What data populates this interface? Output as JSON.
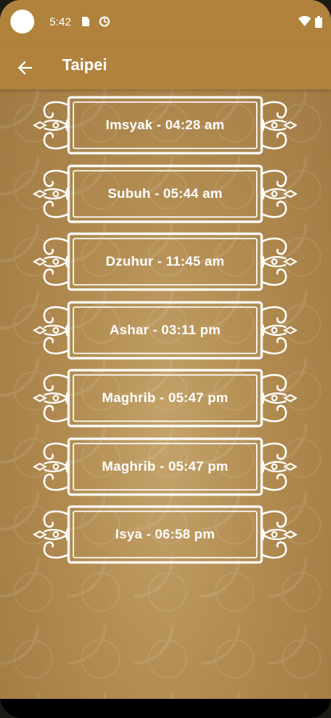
{
  "status_bar": {
    "time": "5:42",
    "icons": [
      "sim-card-icon",
      "sync-icon",
      "wifi-icon",
      "battery-icon"
    ]
  },
  "app_bar": {
    "title": "Taipei",
    "back_icon": "arrow-left-icon"
  },
  "prayer_times": [
    {
      "label": "Imsyak - 04:28 am"
    },
    {
      "label": "Subuh - 05:44 am"
    },
    {
      "label": "Dzuhur - 11:45 am"
    },
    {
      "label": "Ashar - 03:11 pm"
    },
    {
      "label": "Maghrib - 05:47 pm"
    },
    {
      "label": "Maghrib - 05:47 pm"
    },
    {
      "label": "Isya - 06:58 pm"
    }
  ],
  "colors": {
    "app_bar": "#b0823c",
    "background": "#b08a4f",
    "frame": "#ffffff"
  }
}
